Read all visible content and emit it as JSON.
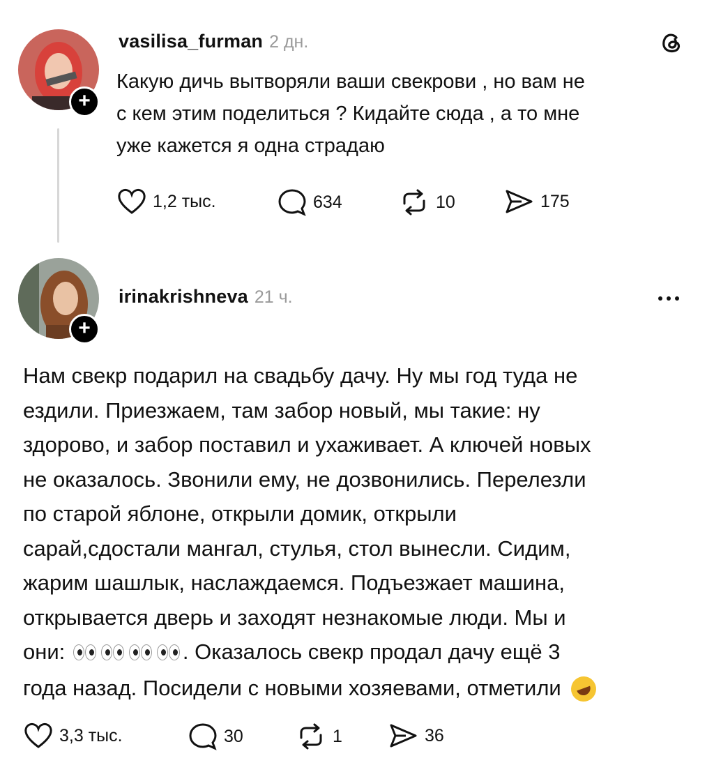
{
  "post": {
    "username": "vasilisa_furman",
    "time": "2 дн.",
    "lines": [
      "Какую дичь вытворяли ваши свекрови , но вам не",
      "с кем этим поделиться ? Кидайте сюда , а то мне",
      "уже кажется я одна страдаю"
    ],
    "likes": "1,2 тыс.",
    "comments": "634",
    "reposts": "10",
    "shares": "175"
  },
  "reply": {
    "username": "irinakrishneva",
    "time": "21 ч.",
    "lines": [
      "Нам свекр подарил на свадьбу дачу. Ну мы год туда не",
      "ездили. Приезжаем, там забор новый, мы такие: ну",
      "здорово, и забор поставил и ухаживает. А ключей новых",
      "не оказалось. Звонили ему, не дозвонились. Перелезли",
      "по старой яблоне, открыли домик, открыли",
      "сарай,сдостали мангал, стулья, стол вынесли. Сидим,",
      "жарим шашлык, наслаждаемся. Подъезжает машина,",
      "открывается дверь и заходят незнакомые люди. Мы и"
    ],
    "line9_prefix": "они:",
    "line9_suffix": ". Оказалось свекр продал дачу ещё 3",
    "line10": "года назад. Посидели с новыми хозяевами, отметили",
    "likes": "3,3 тыс.",
    "comments": "30",
    "reposts": "1",
    "shares": "36"
  },
  "icons": {
    "threads_logo": "threads-logo-icon",
    "follow": "plus-icon",
    "more": "more-dots-icon",
    "like": "heart-icon",
    "comment": "comment-bubble-icon",
    "repost": "repost-icon",
    "share": "send-icon",
    "emoji_eyes": "eyes-emoji",
    "emoji_laugh": "rolling-laughing-emoji"
  },
  "colors": {
    "text": "#111111",
    "muted": "#9a9a9a",
    "thread_line": "#d7d7d7"
  }
}
